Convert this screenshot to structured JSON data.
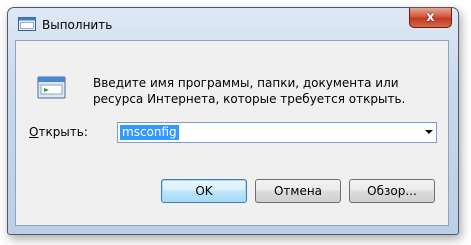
{
  "window": {
    "title": "Выполнить",
    "close_glyph": "x"
  },
  "dialog": {
    "description": "Введите имя программы, папки, документа или ресурса Интернета, которые требуется открыть.",
    "open_label_prefix": "",
    "open_label_accel": "О",
    "open_label_rest": "ткрыть:",
    "input_value": "msconfig"
  },
  "buttons": {
    "ok": "OK",
    "cancel": "Отмена",
    "browse": "Обзор..."
  },
  "icons": {
    "title": "run-dialog-icon",
    "main": "run-program-icon",
    "dropdown": "chevron-down-icon",
    "close": "close-icon"
  },
  "colors": {
    "selection": "#3399ff",
    "close_button": "#c23a1f"
  }
}
